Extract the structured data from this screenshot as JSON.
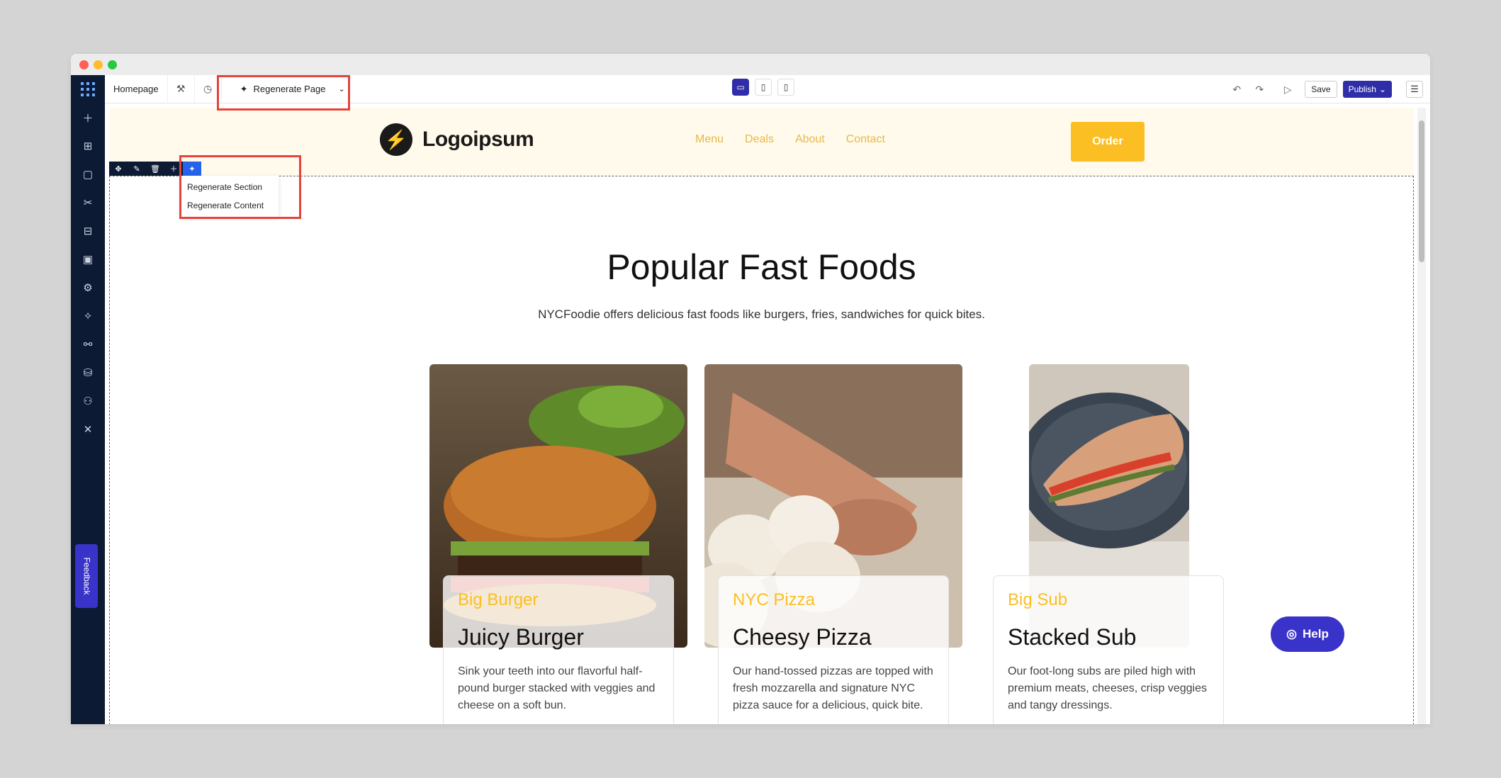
{
  "toolbar": {
    "page_name": "Homepage",
    "regenerate_page_label": "Regenerate Page",
    "save_label": "Save",
    "publish_label": "Publish"
  },
  "section_menu": {
    "items": [
      "Regenerate Section",
      "Regenerate Content"
    ]
  },
  "site": {
    "logo_text": "Logoipsum",
    "nav": [
      "Menu",
      "Deals",
      "About",
      "Contact"
    ],
    "order_label": "Order",
    "headline": "Popular Fast Foods",
    "subhead": "NYCFoodie offers delicious fast foods like burgers, fries, sandwiches for quick bites.",
    "cards": [
      {
        "category": "Big Burger",
        "title": "Juicy Burger",
        "desc": "Sink your teeth into our flavorful half-pound burger stacked with veggies and cheese on a soft bun."
      },
      {
        "category": "NYC Pizza",
        "title": "Cheesy Pizza",
        "desc": "Our hand-tossed pizzas are topped with fresh mozzarella and signature NYC pizza sauce for a delicious, quick bite."
      },
      {
        "category": "Big Sub",
        "title": "Stacked Sub",
        "desc": "Our foot-long subs are piled high with premium meats, cheeses, crisp veggies and tangy dressings."
      }
    ]
  },
  "feedback_label": "Feedback",
  "help_label": "Help",
  "colors": {
    "sidebar": "#0c1a33",
    "accent": "#2f2ea8",
    "highlight": "#e5433b",
    "brand_yellow": "#fbbf24"
  }
}
